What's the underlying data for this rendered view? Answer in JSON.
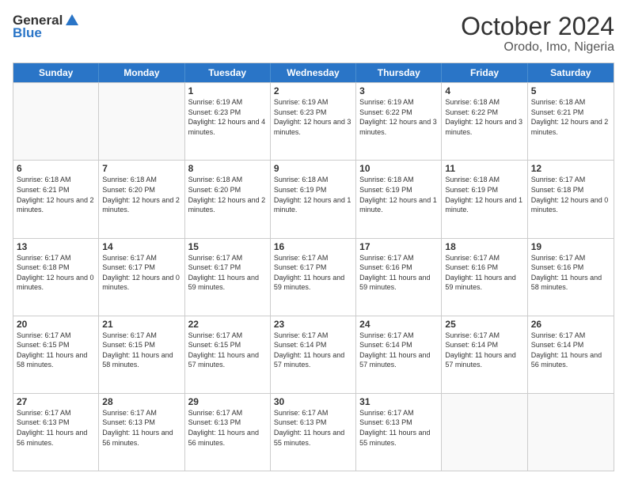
{
  "logo": {
    "general": "General",
    "blue": "Blue"
  },
  "title": "October 2024",
  "location": "Orodo, Imo, Nigeria",
  "weekdays": [
    "Sunday",
    "Monday",
    "Tuesday",
    "Wednesday",
    "Thursday",
    "Friday",
    "Saturday"
  ],
  "weeks": [
    [
      {
        "day": "",
        "empty": true
      },
      {
        "day": "",
        "empty": true
      },
      {
        "day": "1",
        "sunrise": "Sunrise: 6:19 AM",
        "sunset": "Sunset: 6:23 PM",
        "daylight": "Daylight: 12 hours and 4 minutes."
      },
      {
        "day": "2",
        "sunrise": "Sunrise: 6:19 AM",
        "sunset": "Sunset: 6:23 PM",
        "daylight": "Daylight: 12 hours and 3 minutes."
      },
      {
        "day": "3",
        "sunrise": "Sunrise: 6:19 AM",
        "sunset": "Sunset: 6:22 PM",
        "daylight": "Daylight: 12 hours and 3 minutes."
      },
      {
        "day": "4",
        "sunrise": "Sunrise: 6:18 AM",
        "sunset": "Sunset: 6:22 PM",
        "daylight": "Daylight: 12 hours and 3 minutes."
      },
      {
        "day": "5",
        "sunrise": "Sunrise: 6:18 AM",
        "sunset": "Sunset: 6:21 PM",
        "daylight": "Daylight: 12 hours and 2 minutes."
      }
    ],
    [
      {
        "day": "6",
        "sunrise": "Sunrise: 6:18 AM",
        "sunset": "Sunset: 6:21 PM",
        "daylight": "Daylight: 12 hours and 2 minutes."
      },
      {
        "day": "7",
        "sunrise": "Sunrise: 6:18 AM",
        "sunset": "Sunset: 6:20 PM",
        "daylight": "Daylight: 12 hours and 2 minutes."
      },
      {
        "day": "8",
        "sunrise": "Sunrise: 6:18 AM",
        "sunset": "Sunset: 6:20 PM",
        "daylight": "Daylight: 12 hours and 2 minutes."
      },
      {
        "day": "9",
        "sunrise": "Sunrise: 6:18 AM",
        "sunset": "Sunset: 6:19 PM",
        "daylight": "Daylight: 12 hours and 1 minute."
      },
      {
        "day": "10",
        "sunrise": "Sunrise: 6:18 AM",
        "sunset": "Sunset: 6:19 PM",
        "daylight": "Daylight: 12 hours and 1 minute."
      },
      {
        "day": "11",
        "sunrise": "Sunrise: 6:18 AM",
        "sunset": "Sunset: 6:19 PM",
        "daylight": "Daylight: 12 hours and 1 minute."
      },
      {
        "day": "12",
        "sunrise": "Sunrise: 6:17 AM",
        "sunset": "Sunset: 6:18 PM",
        "daylight": "Daylight: 12 hours and 0 minutes."
      }
    ],
    [
      {
        "day": "13",
        "sunrise": "Sunrise: 6:17 AM",
        "sunset": "Sunset: 6:18 PM",
        "daylight": "Daylight: 12 hours and 0 minutes."
      },
      {
        "day": "14",
        "sunrise": "Sunrise: 6:17 AM",
        "sunset": "Sunset: 6:17 PM",
        "daylight": "Daylight: 12 hours and 0 minutes."
      },
      {
        "day": "15",
        "sunrise": "Sunrise: 6:17 AM",
        "sunset": "Sunset: 6:17 PM",
        "daylight": "Daylight: 11 hours and 59 minutes."
      },
      {
        "day": "16",
        "sunrise": "Sunrise: 6:17 AM",
        "sunset": "Sunset: 6:17 PM",
        "daylight": "Daylight: 11 hours and 59 minutes."
      },
      {
        "day": "17",
        "sunrise": "Sunrise: 6:17 AM",
        "sunset": "Sunset: 6:16 PM",
        "daylight": "Daylight: 11 hours and 59 minutes."
      },
      {
        "day": "18",
        "sunrise": "Sunrise: 6:17 AM",
        "sunset": "Sunset: 6:16 PM",
        "daylight": "Daylight: 11 hours and 59 minutes."
      },
      {
        "day": "19",
        "sunrise": "Sunrise: 6:17 AM",
        "sunset": "Sunset: 6:16 PM",
        "daylight": "Daylight: 11 hours and 58 minutes."
      }
    ],
    [
      {
        "day": "20",
        "sunrise": "Sunrise: 6:17 AM",
        "sunset": "Sunset: 6:15 PM",
        "daylight": "Daylight: 11 hours and 58 minutes."
      },
      {
        "day": "21",
        "sunrise": "Sunrise: 6:17 AM",
        "sunset": "Sunset: 6:15 PM",
        "daylight": "Daylight: 11 hours and 58 minutes."
      },
      {
        "day": "22",
        "sunrise": "Sunrise: 6:17 AM",
        "sunset": "Sunset: 6:15 PM",
        "daylight": "Daylight: 11 hours and 57 minutes."
      },
      {
        "day": "23",
        "sunrise": "Sunrise: 6:17 AM",
        "sunset": "Sunset: 6:14 PM",
        "daylight": "Daylight: 11 hours and 57 minutes."
      },
      {
        "day": "24",
        "sunrise": "Sunrise: 6:17 AM",
        "sunset": "Sunset: 6:14 PM",
        "daylight": "Daylight: 11 hours and 57 minutes."
      },
      {
        "day": "25",
        "sunrise": "Sunrise: 6:17 AM",
        "sunset": "Sunset: 6:14 PM",
        "daylight": "Daylight: 11 hours and 57 minutes."
      },
      {
        "day": "26",
        "sunrise": "Sunrise: 6:17 AM",
        "sunset": "Sunset: 6:14 PM",
        "daylight": "Daylight: 11 hours and 56 minutes."
      }
    ],
    [
      {
        "day": "27",
        "sunrise": "Sunrise: 6:17 AM",
        "sunset": "Sunset: 6:13 PM",
        "daylight": "Daylight: 11 hours and 56 minutes."
      },
      {
        "day": "28",
        "sunrise": "Sunrise: 6:17 AM",
        "sunset": "Sunset: 6:13 PM",
        "daylight": "Daylight: 11 hours and 56 minutes."
      },
      {
        "day": "29",
        "sunrise": "Sunrise: 6:17 AM",
        "sunset": "Sunset: 6:13 PM",
        "daylight": "Daylight: 11 hours and 56 minutes."
      },
      {
        "day": "30",
        "sunrise": "Sunrise: 6:17 AM",
        "sunset": "Sunset: 6:13 PM",
        "daylight": "Daylight: 11 hours and 55 minutes."
      },
      {
        "day": "31",
        "sunrise": "Sunrise: 6:17 AM",
        "sunset": "Sunset: 6:13 PM",
        "daylight": "Daylight: 11 hours and 55 minutes."
      },
      {
        "day": "",
        "empty": true
      },
      {
        "day": "",
        "empty": true
      }
    ]
  ]
}
